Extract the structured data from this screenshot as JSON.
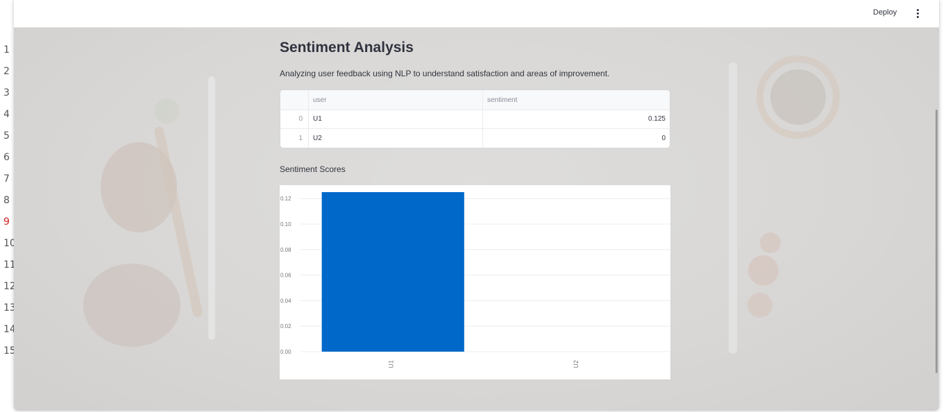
{
  "left_strip": {
    "line_numbers": [
      "1",
      "2",
      "3",
      "4",
      "5",
      "6",
      "7",
      "8",
      "9",
      "10",
      "11",
      "12",
      "13",
      "14",
      "15"
    ],
    "highlight": "9"
  },
  "header": {
    "deploy_label": "Deploy",
    "menu_icon": "kebab-menu-icon"
  },
  "main": {
    "title": "Sentiment Analysis",
    "subtitle": "Analyzing user feedback using NLP to understand satisfaction and areas of improvement.",
    "table": {
      "columns": [
        "",
        "user",
        "sentiment"
      ],
      "rows": [
        {
          "index": "0",
          "user": "U1",
          "sentiment": "0.125"
        },
        {
          "index": "1",
          "user": "U2",
          "sentiment": "0"
        }
      ]
    },
    "chart_title": "Sentiment Scores"
  },
  "colors": {
    "bar": "#0068c9",
    "background_tint": "#d6d4d1"
  },
  "chart_data": {
    "type": "bar",
    "title": "Sentiment Scores",
    "categories": [
      "U1",
      "U2"
    ],
    "values": [
      0.125,
      0
    ],
    "xlabel": "",
    "ylabel": "",
    "ylim": [
      0,
      0.125
    ],
    "yticks": [
      "0.00",
      "0.02",
      "0.04",
      "0.06",
      "0.08",
      "0.10",
      "0.12"
    ],
    "grid": true
  }
}
